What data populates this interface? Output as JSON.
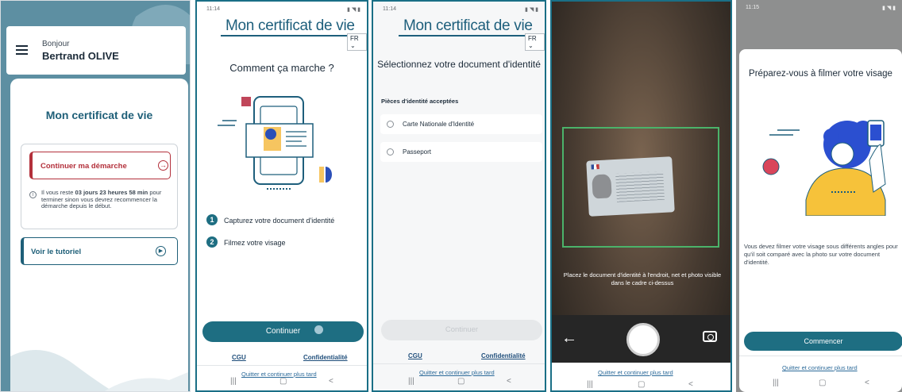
{
  "colors": {
    "primary": "#1e6e82",
    "brand": "#1e5f7c",
    "alert": "#b3303b",
    "camera_frame": "#4bb36a"
  },
  "screen1": {
    "greeting": "Bonjour",
    "user_name": "Bertrand OLIVE",
    "title": "Mon certificat de vie",
    "continue_label": "Continuer ma démarche",
    "info_prefix": "Il vous reste ",
    "info_time": "03 jours 23 heures 58 min",
    "info_suffix": " pour terminer sinon vous devrez recommencer la démarche depuis le début.",
    "tutorial_label": "Voir le tutoriel"
  },
  "screen2": {
    "status_time": "11:14",
    "brand": "Mon certificat de vie",
    "language": "FR",
    "title": "Comment ça marche ?",
    "steps": [
      {
        "number": "1",
        "label": "Capturez votre document d'identité"
      },
      {
        "number": "2",
        "label": "Filmez votre visage"
      }
    ],
    "continue_button": "Continuer",
    "cgu_link": "CGU",
    "privacy_link": "Confidentialité",
    "quit_link": "Quitter et continuer plus tard"
  },
  "screen3": {
    "status_time": "11:14",
    "brand": "Mon certificat de vie",
    "language": "FR",
    "title": "Sélectionnez votre document d'identité",
    "subtitle": "Pièces d'identité acceptées",
    "options": [
      "Carte Nationale d'Identité",
      "Passeport"
    ],
    "continue_button": "Continuer",
    "cgu_link": "CGU",
    "privacy_link": "Confidentialité",
    "quit_link": "Quitter et continuer plus tard"
  },
  "screen4": {
    "instruction": "Placez le document d'identité à l'endroit, net et photo visible dans le cadre ci-dessus",
    "quit_link": "Quitter et continuer plus tard"
  },
  "screen5": {
    "status_time": "11:15",
    "title": "Préparez-vous à filmer votre visage",
    "description": "Vous devez filmer votre visage sous différents angles pour qu'il soit comparé avec la photo sur votre document d'identité.",
    "start_button": "Commencer",
    "quit_link": "Quitter et continuer plus tard"
  },
  "nav_icons": [
    "recent-apps-icon",
    "home-icon",
    "back-icon"
  ]
}
